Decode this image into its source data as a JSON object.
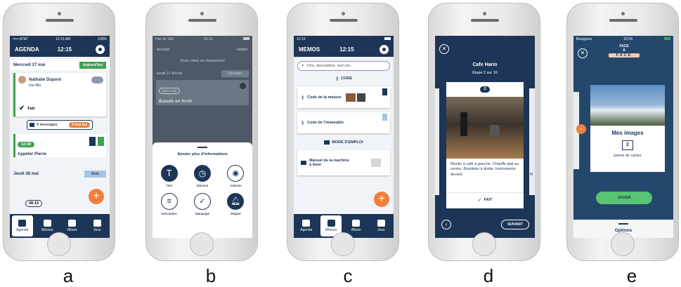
{
  "panel_labels": [
    "a",
    "b",
    "c",
    "d",
    "e"
  ],
  "a": {
    "status_left": "••••• AT&T",
    "status_time": "12:15 AM",
    "status_right": "100%",
    "header_title": "AGENDA",
    "header_time": "12:15",
    "day1_label": "Mercredi 27 mai",
    "today_badge": "Aujourd'hui",
    "contact_name": "Nathalie Dupont",
    "contact_subtitle": "ma fille",
    "done_label": "Fait",
    "messages_label": "4 messages",
    "unread_badge": "3 non lus",
    "event_time": "12:30",
    "event_title": "Appeler Pierre",
    "day2_label": "Jeudi 28 mai",
    "tomorrow_badge": "Dem",
    "event2_time": "08:15",
    "tabs": [
      "Agenda",
      "Mémos",
      "Album",
      "Jeux"
    ],
    "fab": "+"
  },
  "b": {
    "status_left": "Pas de SIM",
    "status_time": "02:13",
    "cancel": "Annuler",
    "validate": "Valider",
    "creating": "Vous créez un événement",
    "date": "Jeudi 17 février",
    "tomorrow": "Demain",
    "tag": "Après-midi",
    "event_title": "Balade en forêt",
    "sheet_title": "Ajouter plus d'informations",
    "options": [
      "Titre",
      "Moment",
      "Adresse",
      "Description",
      "Marquage",
      "Rappel"
    ]
  },
  "c": {
    "status_time": "12:15",
    "header_title": "MEMOS",
    "header_time": "12:15",
    "search_placeholder": "Titre, description, mot clé...",
    "section_code": "CODE",
    "item1": "Code de la maison",
    "item2": "Code de l'immeuble",
    "section_manual": "MODE D'EMPLOI",
    "item3_line1": "Manuel de la machine",
    "item3_line2": "à laver",
    "tabs": [
      "Agenda",
      "Mémos",
      "Album",
      "Jeux"
    ],
    "fab": "+"
  },
  "d": {
    "title": "Cafe Hario",
    "step": "Étape 2 sur 16",
    "step_number": "2",
    "description": "Moulin à café à gauche. Chauffe plat au centre. Bouilloire à droite. Instruments devant.",
    "done_label": "FAIT",
    "next_label": "SUIVANT",
    "side_letter_right": "M",
    "side_letter_right2": "f"
  },
  "e": {
    "status_left": "Bouygues",
    "status_time": "22:54",
    "logo_top": "FACE",
    "logo_mid": "À",
    "logo_banner": "FACE",
    "card_title": "Mes images",
    "pairs_count": "2",
    "pairs_label": "paires de cartes",
    "play_label": "JOUER",
    "options_label": "Options"
  }
}
